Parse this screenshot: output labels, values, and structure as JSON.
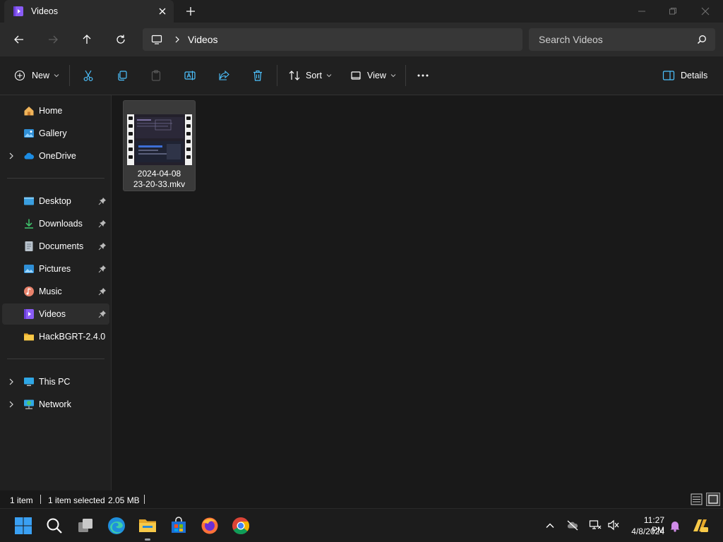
{
  "window": {
    "tab_title": "Videos",
    "new_tab_symbol": "+"
  },
  "nav": {
    "location": "Videos",
    "search_placeholder": "Search Videos"
  },
  "toolbar": {
    "new_label": "New",
    "sort_label": "Sort",
    "view_label": "View",
    "more_label": "...",
    "details_label": "Details"
  },
  "sidebar": {
    "items": [
      {
        "label": "Home",
        "icon": "home-icon"
      },
      {
        "label": "Gallery",
        "icon": "gallery-icon"
      },
      {
        "label": "OneDrive",
        "icon": "onedrive-icon"
      },
      {
        "label": "Desktop",
        "icon": "desktop-folder-icon"
      },
      {
        "label": "Downloads",
        "icon": "downloads-folder-icon"
      },
      {
        "label": "Documents",
        "icon": "documents-folder-icon"
      },
      {
        "label": "Pictures",
        "icon": "pictures-folder-icon"
      },
      {
        "label": "Music",
        "icon": "music-folder-icon"
      },
      {
        "label": "Videos",
        "icon": "videos-folder-icon"
      },
      {
        "label": "HackBGRT-2.4.0",
        "icon": "folder-icon"
      },
      {
        "label": "This PC",
        "icon": "this-pc-icon"
      },
      {
        "label": "Network",
        "icon": "network-icon"
      }
    ]
  },
  "files": [
    {
      "name_line1": "2024-04-08",
      "name_line2": "23-20-33.mkv"
    }
  ],
  "status": {
    "count": "1 item",
    "selected": "1 item selected",
    "size": "2.05 MB"
  },
  "taskbar": {
    "time": "11:27 PM",
    "date": "4/8/2024"
  },
  "colors": {
    "accent": "#4cc2ff",
    "folder": "#f7c948",
    "background": "#191919",
    "selected": "#2d2d2d"
  }
}
